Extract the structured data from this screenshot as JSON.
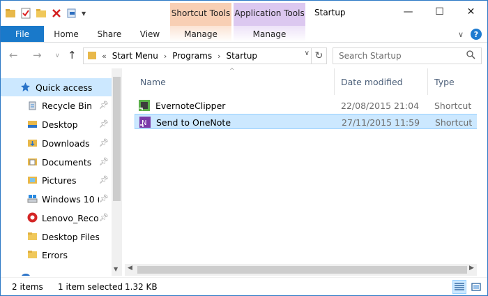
{
  "window": {
    "title": "Startup",
    "minimize_glyph": "—",
    "maximize_glyph": "☐",
    "close_glyph": "✕"
  },
  "context_tabs": {
    "shortcut_tools": "Shortcut Tools",
    "application_tools": "Application Tools"
  },
  "ribbon": {
    "file": "File",
    "home": "Home",
    "share": "Share",
    "view": "View",
    "manage_shortcut": "Manage",
    "manage_application": "Manage"
  },
  "address": {
    "overflow": "«",
    "crumbs": [
      "Start Menu",
      "Programs",
      "Startup"
    ],
    "search_placeholder": "Search Startup"
  },
  "nav": {
    "items": [
      {
        "label": "Quick access",
        "icon": "star-icon",
        "pinned": false
      },
      {
        "label": "Recycle Bin",
        "icon": "recycle-bin-icon",
        "pinned": true
      },
      {
        "label": "Desktop",
        "icon": "desktop-folder-icon",
        "pinned": true
      },
      {
        "label": "Downloads",
        "icon": "downloads-folder-icon",
        "pinned": true
      },
      {
        "label": "Documents",
        "icon": "documents-folder-icon",
        "pinned": true
      },
      {
        "label": "Pictures",
        "icon": "pictures-folder-icon",
        "pinned": true
      },
      {
        "label": "Windows 10 (",
        "icon": "drive-icon",
        "pinned": true
      },
      {
        "label": "Lenovo_Recov",
        "icon": "lenovo-drive-icon",
        "pinned": true
      },
      {
        "label": "Desktop Files",
        "icon": "folder-icon",
        "pinned": false
      },
      {
        "label": "Errors",
        "icon": "folder-icon",
        "pinned": false
      }
    ]
  },
  "columns": {
    "name": "Name",
    "date": "Date modified",
    "type": "Type"
  },
  "files": [
    {
      "name": "EvernoteClipper",
      "date": "22/08/2015 21:04",
      "type": "Shortcut",
      "icon": "evernote-shortcut-icon"
    },
    {
      "name": "Send to OneNote",
      "date": "27/11/2015 11:59",
      "type": "Shortcut",
      "icon": "onenote-shortcut-icon"
    }
  ],
  "status": {
    "items": "2 items",
    "selected": "1 item selected",
    "size": "1.32 KB"
  },
  "colors": {
    "accent": "#1979ca",
    "selection": "#cce8ff",
    "shortcut_tools": "#f8cfb4",
    "application_tools": "#dcc8f0"
  }
}
